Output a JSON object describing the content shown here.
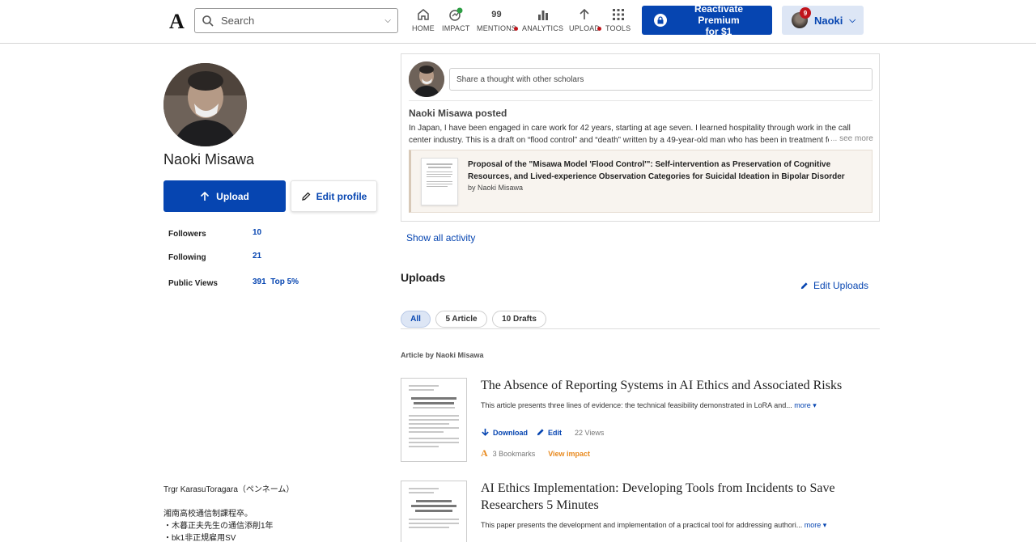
{
  "header": {
    "logo": "A",
    "search_placeholder": "Search",
    "nav": [
      {
        "label": "HOME",
        "icon": "home-icon"
      },
      {
        "label": "IMPACT",
        "icon": "impact-icon"
      },
      {
        "label": "MENTIONS",
        "icon": "mentions-icon",
        "count": "99"
      },
      {
        "label": "ANALYTICS",
        "icon": "analytics-icon"
      },
      {
        "label": "UPLOAD",
        "icon": "upload-icon"
      },
      {
        "label": "TOOLS",
        "icon": "tools-icon"
      }
    ],
    "premium_line1": "Reactivate Premium",
    "premium_line2": "for $1",
    "user_name": "Naoki",
    "notif_count": "9"
  },
  "profile": {
    "name": "Naoki Misawa",
    "upload_label": "Upload",
    "edit_label": "Edit profile",
    "stats": [
      {
        "label": "Followers",
        "value": "10"
      },
      {
        "label": "Following",
        "value": "21"
      },
      {
        "label": "Public Views",
        "value": "391",
        "extra": "Top 5%"
      }
    ],
    "bio": [
      "Trgr KarasuToragara（ペンネーム）",
      "",
      "湘南高校通信制課程卒。",
      "・木暮正夫先生の通信添削1年",
      "・bk1非正規雇用SV"
    ]
  },
  "activity": {
    "share_placeholder": "Share a thought with other scholars",
    "posted_by": "Naoki Misawa posted",
    "post_text": "In Japan, I have been engaged in care work for 42 years, starting at age seven. I learned hospitality through work in the call center industry. This is a draft on “flood control” and “death” written by a 49-year-old man who has been in treatment for",
    "see_more": "... see more",
    "quoted_title": "Proposal of the \"Misawa Model 'Flood Control'\": Self-intervention as Preservation of Cognitive Resources, and Lived-experience Observation Categories for Suicidal Ideation in Bipolar Disorder",
    "quoted_by": "by Naoki Misawa",
    "show_all": "Show all activity"
  },
  "uploads": {
    "title": "Uploads",
    "edit_label": "Edit Uploads",
    "chips": [
      "All",
      "5 Article",
      "10 Drafts"
    ],
    "article_by": "Article by Naoki Misawa",
    "papers": [
      {
        "title": "The Absence of Reporting Systems in AI Ethics and Associated Risks",
        "abstract": "This article presents three lines of evidence: the technical feasibility demonstrated in LoRA and...",
        "more": "more",
        "download": "Download",
        "edit": "Edit",
        "views": "22 Views",
        "bookmarks": "3 Bookmarks",
        "impact": "View impact"
      },
      {
        "title": "AI Ethics Implementation: Developing Tools from Incidents to Save Researchers 5 Minutes",
        "abstract": "This paper presents the development and implementation of a practical tool for addressing authori...",
        "more": "more"
      }
    ]
  },
  "colors": {
    "brand": "#0645b1",
    "notif": "#c0151c",
    "impact": "#e8891d"
  }
}
